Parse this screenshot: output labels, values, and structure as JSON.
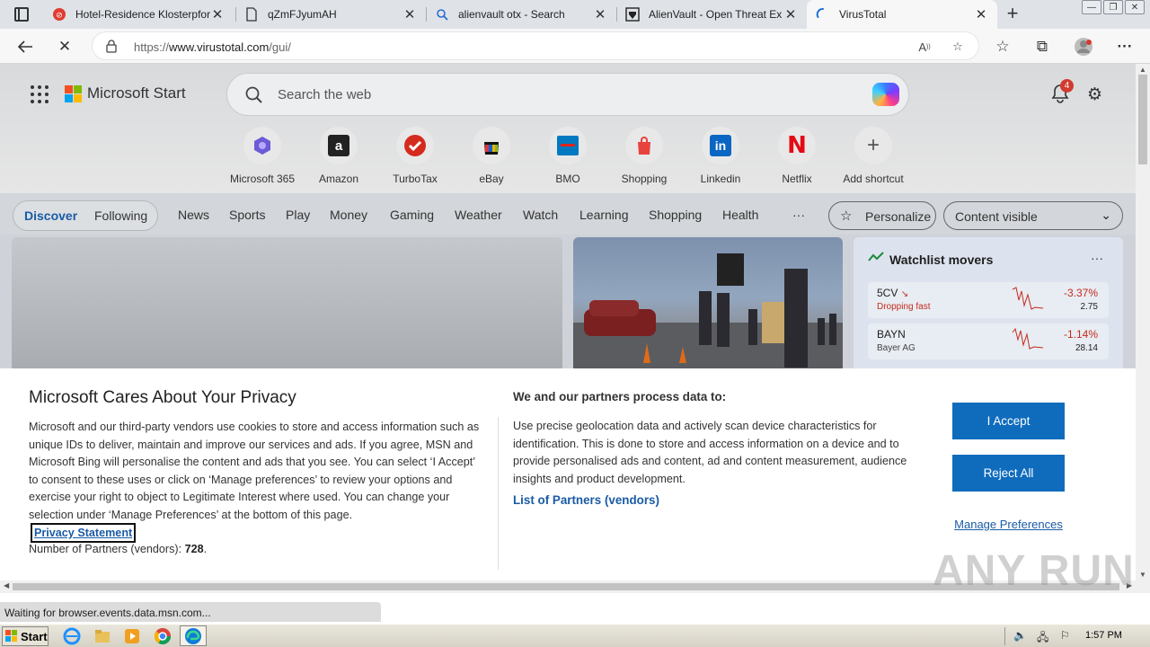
{
  "browser": {
    "tabs": [
      {
        "title": "Hotel-Residence Klosterpfor",
        "active": false
      },
      {
        "title": "qZmFJyumAH",
        "active": false
      },
      {
        "title": "alienvault otx - Search",
        "active": false
      },
      {
        "title": "AlienVault - Open Threat Ex",
        "active": false
      },
      {
        "title": "VirusTotal",
        "active": true
      }
    ],
    "url_prefix": "https://",
    "url_main": "www.virustotal.com",
    "url_path": "/gui/"
  },
  "msn": {
    "brand": "Microsoft Start",
    "search_placeholder": "Search the web",
    "notification_count": "4",
    "shortcuts": [
      {
        "label": "Microsoft 365",
        "icon": "microsoft-365-icon"
      },
      {
        "label": "Amazon",
        "icon": "amazon-icon"
      },
      {
        "label": "TurboTax",
        "icon": "turbotax-icon"
      },
      {
        "label": "eBay",
        "icon": "ebay-icon"
      },
      {
        "label": "BMO",
        "icon": "bmo-icon"
      },
      {
        "label": "Shopping",
        "icon": "shopping-icon"
      },
      {
        "label": "Linkedin",
        "icon": "linkedin-icon"
      },
      {
        "label": "Netflix",
        "icon": "netflix-icon"
      },
      {
        "label": "Add shortcut",
        "icon": "plus-icon"
      }
    ],
    "discover": "Discover",
    "following": "Following",
    "categories": [
      "News",
      "Sports",
      "Play",
      "Money",
      "Gaming",
      "Weather",
      "Watch",
      "Learning",
      "Shopping",
      "Health"
    ],
    "more": "···",
    "personalize": "Personalize",
    "content_visible": "Content visible",
    "watchlist": {
      "title": "Watchlist movers",
      "more": "···",
      "items": [
        {
          "symbol": "5CV",
          "subtitle": "Dropping fast",
          "change": "-3.37%",
          "price": "2.75"
        },
        {
          "symbol": "BAYN",
          "subtitle": "Bayer AG",
          "change": "-1.14%",
          "price": "28.14"
        }
      ]
    }
  },
  "privacy": {
    "title": "Microsoft Cares About Your Privacy",
    "body": "Microsoft and our third-party vendors use cookies to store and access information such as unique IDs to deliver, maintain and improve our services and ads. If you agree, MSN and Microsoft Bing will personalise the content and ads that you see. You can select ‘I Accept’ to consent to these uses or click on ‘Manage preferences’ to review your options and exercise your right to object to Legitimate Interest where used.  You can change your selection under ‘Manage Preferences’ at the bottom of this page.",
    "privacy_link": "Privacy Statement",
    "partners_label": "Number of Partners (vendors): ",
    "partners_count": "728",
    "partners_suffix": ".",
    "process_heading": "We and our partners process data to:",
    "process_body": "Use precise geolocation data and actively scan device characteristics for identification. This is done to store and access information on a device and to provide personalised ads and content, ad and content measurement, audience insights and product development.",
    "partners_link": "List of Partners (vendors)",
    "accept": "I Accept",
    "reject": "Reject All",
    "manage": "Manage Preferences"
  },
  "status": "Waiting for browser.events.data.msn.com...",
  "watermark": "ANY RUN",
  "taskbar": {
    "start": "Start",
    "clock": "1:57 PM"
  },
  "colors": {
    "accent_blue": "#0f6cbd",
    "link_blue": "#1a5ba6",
    "loss_red": "#c42b1c"
  }
}
